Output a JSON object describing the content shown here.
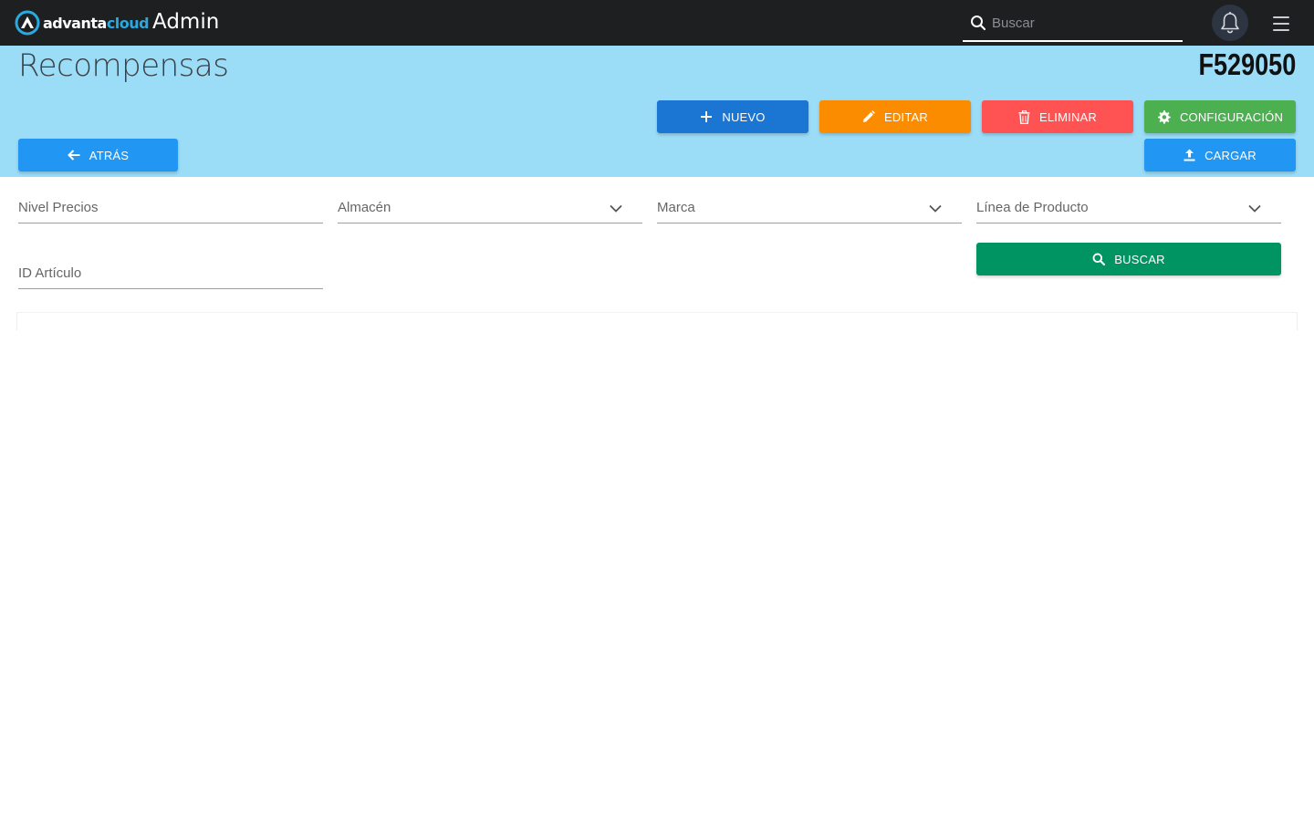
{
  "topbar": {
    "brand_part1": "advanta",
    "brand_part2": "cloud",
    "app_title": "Admin",
    "search_placeholder": "Buscar",
    "background": "#1e1f21",
    "brand_accent": "#29a9e0",
    "icons": {
      "search": "search-icon",
      "notifications": "bell-icon",
      "menu": "hamburger-menu-icon"
    }
  },
  "header": {
    "title": "Recompensas",
    "code": "F529050",
    "background": "#9bdcf7"
  },
  "toolbar": {
    "nuevo": {
      "label": "NUEVO",
      "color": "#1a76d2",
      "icon": "plus-icon"
    },
    "editar": {
      "label": "EDITAR",
      "color": "#fb8c00",
      "icon": "pencil-icon"
    },
    "eliminar": {
      "label": "ELIMINAR",
      "color": "#ff5252",
      "icon": "trash-icon"
    },
    "configuracion": {
      "label": "CONFIGURACIÓN",
      "color": "#4caf50",
      "icon": "gear-icon"
    },
    "atras": {
      "label": "ATRÁS",
      "color": "#2196f3",
      "icon": "arrow-left-icon"
    },
    "cargar": {
      "label": "CARGAR",
      "color": "#2196f3",
      "icon": "upload-icon"
    }
  },
  "filters": {
    "nivel_precios": {
      "label": "Nivel Precios",
      "type": "text"
    },
    "almacen": {
      "label": "Almacén",
      "type": "select"
    },
    "marca": {
      "label": "Marca",
      "type": "select"
    },
    "linea_producto": {
      "label": "Línea de Producto",
      "type": "select"
    },
    "id_articulo": {
      "label": "ID Artículo",
      "type": "text"
    },
    "buscar": {
      "label": "BUSCAR",
      "color": "#009463",
      "icon": "search-icon"
    }
  }
}
